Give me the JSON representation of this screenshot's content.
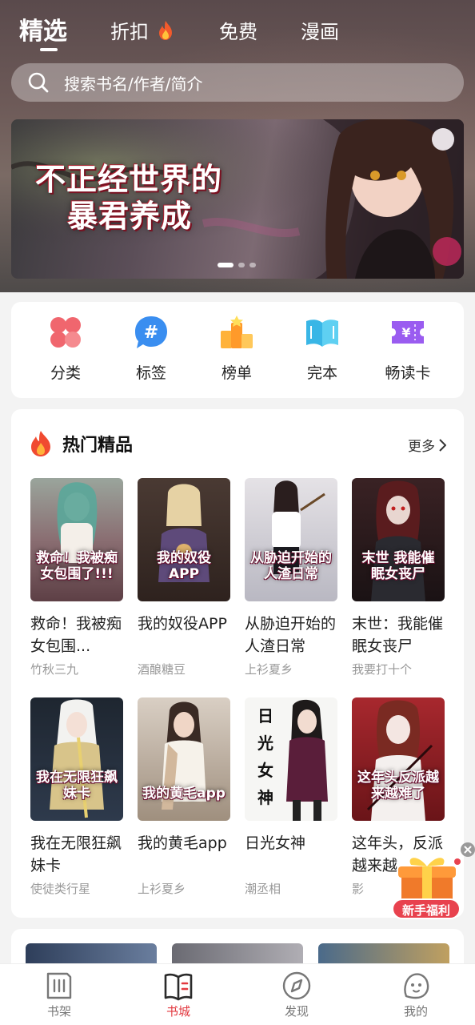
{
  "top_tabs": {
    "selected": "精选",
    "discount": "折扣",
    "free": "免费",
    "comic": "漫画"
  },
  "search": {
    "placeholder": "搜索书名/作者/简介"
  },
  "banner": {
    "title_line1": "不正经世界的",
    "title_line2": "暴君养成",
    "page_count": 3,
    "active_page": 1
  },
  "categories": [
    {
      "label": "分类",
      "icon": "clover-category-icon"
    },
    {
      "label": "标签",
      "icon": "hashtag-tag-icon"
    },
    {
      "label": "榜单",
      "icon": "ranking-podium-icon"
    },
    {
      "label": "完本",
      "icon": "open-book-icon"
    },
    {
      "label": "畅读卡",
      "icon": "ticket-card-icon"
    }
  ],
  "hot": {
    "title": "热门精品",
    "more": "更多",
    "books": [
      {
        "title": "救命！我被痴女包围...",
        "author": "竹秋三九",
        "cover_text": "救命！我被痴女包围了!!!",
        "cover_color": "#8a6e72"
      },
      {
        "title": "我的奴役APP",
        "author": "酒酿糖豆",
        "cover_text": "我的奴役APP",
        "cover_color": "#3d2f2b"
      },
      {
        "title": "从胁迫开始的人渣日常",
        "author": "上衫夏乡",
        "cover_text": "从胁迫开始的人渣日常",
        "cover_color": "#c9c6cc"
      },
      {
        "title": "末世：我能催眠女丧尸",
        "author": "我要打十个",
        "cover_text": "末世 我能催眠女丧尸",
        "cover_color": "#2a1c1e"
      },
      {
        "title": "我在无限狂飙妹卡",
        "author": "使徒类行星",
        "cover_text": "我在无限狂飙妹卡",
        "cover_color": "#26303d"
      },
      {
        "title": "我的黄毛app",
        "author": "上衫夏乡",
        "cover_text": "我的黄毛app",
        "cover_color": "#b7a796"
      },
      {
        "title": "日光女神",
        "author": "潮丞相",
        "cover_text": "日光女神",
        "cover_color": "#f4f4f2"
      },
      {
        "title": "这年头，反派越来越...",
        "author": "影",
        "cover_text": "这年头反派越来越难了",
        "cover_color": "#8c1c22"
      }
    ]
  },
  "gift": {
    "label": "新手福利"
  },
  "bottom_nav": [
    {
      "label": "书架",
      "icon": "bookshelf-icon",
      "active": false
    },
    {
      "label": "书城",
      "icon": "bookstore-icon",
      "active": true
    },
    {
      "label": "发现",
      "icon": "compass-discover-icon",
      "active": false
    },
    {
      "label": "我的",
      "icon": "profile-face-icon",
      "active": false
    }
  ],
  "colors": {
    "accent": "#e2383f",
    "fire": "#f04a30"
  }
}
